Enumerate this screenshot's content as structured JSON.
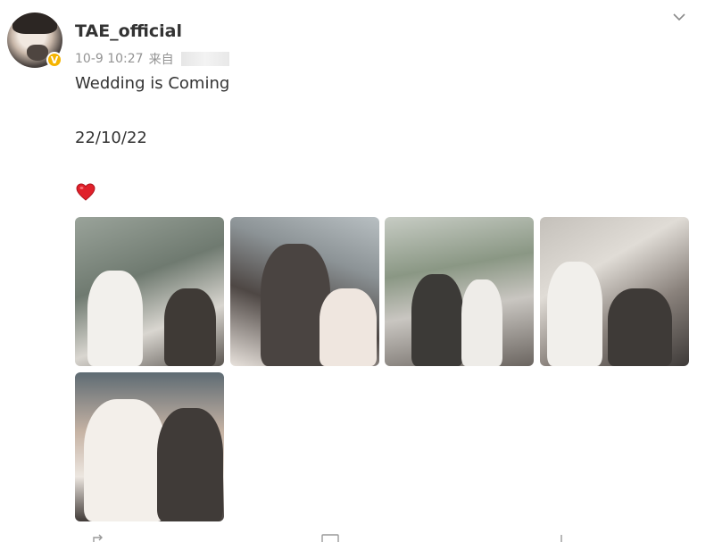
{
  "post": {
    "username": "TAE_official",
    "timestamp": "10-9 10:27",
    "source_prefix": "来自",
    "lines": [
      "Wedding is Coming",
      "22/10/22"
    ],
    "emoji": "heart-emoji"
  },
  "icons": {
    "verified": "verified-badge-icon",
    "menu": "chevron-down-icon",
    "heart": "heart-icon"
  },
  "colors": {
    "verified": "#f5b400",
    "heart": "#e0202a"
  }
}
